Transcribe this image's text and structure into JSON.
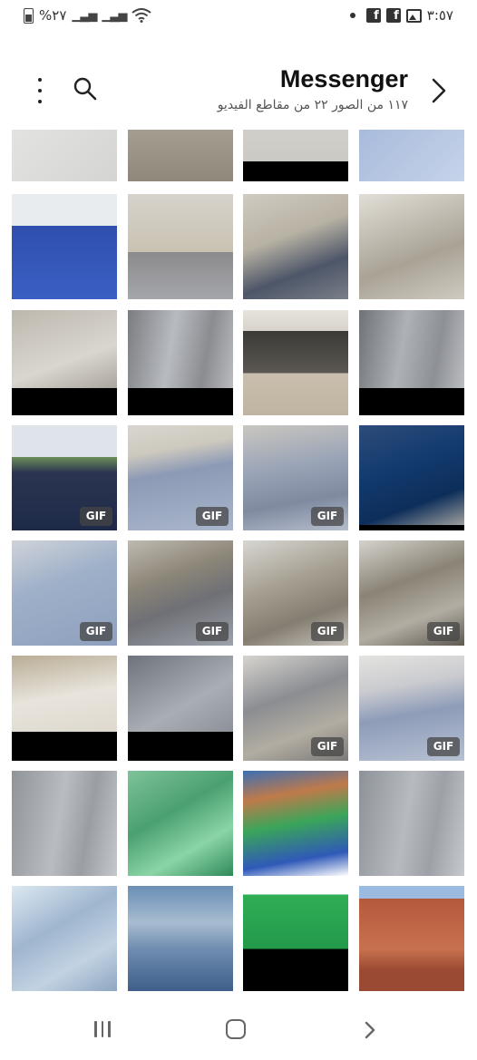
{
  "status_bar": {
    "battery_text": "%٢٧",
    "time": "٣:٥٧"
  },
  "header": {
    "title": "Messenger",
    "subtitle": "١١٧ من الصور ٢٢ من مقاطع الفيديو"
  },
  "gif_label": "GIF",
  "thumbnails": [
    {
      "row": 0,
      "col": 0,
      "bg": "linear-gradient(135deg,#e8e8e6,#d4d4d2)",
      "gif": false,
      "letterbox": 0
    },
    {
      "row": 0,
      "col": 1,
      "bg": "linear-gradient(180deg,#b9b4a8,#8f887a)",
      "gif": false,
      "letterbox": 0
    },
    {
      "row": 0,
      "col": 2,
      "bg": "linear-gradient(180deg,#d9d8d4,#c8c6c0)",
      "gif": false,
      "letterbox": 22
    },
    {
      "row": 0,
      "col": 3,
      "bg": "linear-gradient(135deg,#9eb3d6,#c6d3ea)",
      "gif": false,
      "letterbox": 0
    },
    {
      "row": 1,
      "col": 0,
      "bg": "linear-gradient(180deg,#e9ecef 0%,#e9ecef 30%,#2f4fae 30%,#3a5fc4 100%)",
      "gif": false,
      "letterbox": 0
    },
    {
      "row": 1,
      "col": 1,
      "bg": "linear-gradient(180deg,#d6d3cc 0%,#c9c2b2 55%,#8b8b8d 55%,#a5a6aa 100%)",
      "gif": false,
      "letterbox": 0
    },
    {
      "row": 1,
      "col": 2,
      "bg": "linear-gradient(160deg,#cfcbc1 0%,#b8b2a4 40%,#4d5668 70%,#7a7f88 100%)",
      "gif": false,
      "letterbox": 0
    },
    {
      "row": 1,
      "col": 3,
      "bg": "linear-gradient(160deg,#e1ded6,#a9a396 60%,#cfcac0)",
      "gif": false,
      "letterbox": 0
    },
    {
      "row": 2,
      "col": 0,
      "bg": "linear-gradient(160deg,#bdb8ae,#d9d6cf 50%,#8e887d)",
      "gif": false,
      "letterbox": 30
    },
    {
      "row": 2,
      "col": 1,
      "bg": "linear-gradient(100deg,#7a7c80,#b8bbc0 40%,#8a8c90 70%,#c0c2c6)",
      "gif": false,
      "letterbox": 30
    },
    {
      "row": 2,
      "col": 2,
      "bg": "linear-gradient(180deg,#e7e4dd 0%,#d7d3ca 20%,#3c3a36 20%,#5b5853 60%,#c9bfae 60%,#bfb4a1 100%)",
      "gif": false,
      "letterbox": 0
    },
    {
      "row": 2,
      "col": 3,
      "bg": "linear-gradient(100deg,#6f7276,#aeb1b6 40%,#8d9095 70%,#c2c4c8)",
      "gif": false,
      "letterbox": 30
    },
    {
      "row": 3,
      "col": 0,
      "bg": "linear-gradient(180deg,#dfe4ea 0%,#dfe4ea 30%,#6d8f58 30%,#2b3550 45%,#1d2a48 100%)",
      "gif": true,
      "letterbox": 0
    },
    {
      "row": 3,
      "col": 1,
      "bg": "linear-gradient(170deg,#d8d6cf 0%,#cdc9bf 25%,#8c9ab5 45%,#a9b6cc 100%)",
      "gif": true,
      "letterbox": 0
    },
    {
      "row": 3,
      "col": 2,
      "bg": "linear-gradient(170deg,#c9c6bf 0%,#9aa4b7 40%,#7f8aa0 70%,#b5bdcc 100%)",
      "gif": true,
      "letterbox": 0
    },
    {
      "row": 3,
      "col": 3,
      "bg": "linear-gradient(160deg,#2d4c7a 0%,#123a6e 40%,#0d2e5a 70%,#b5b0a6 100%)",
      "gif": false,
      "letterbox": 6
    },
    {
      "row": 4,
      "col": 0,
      "bg": "linear-gradient(160deg,#cfd3d9,#9fb0c9 40%,#8ea0bd 100%)",
      "gif": true,
      "letterbox": 0
    },
    {
      "row": 4,
      "col": 1,
      "bg": "linear-gradient(160deg,#bfbab0,#8c8678 35%,#6f7076 60%,#9ea2ab)",
      "gif": true,
      "letterbox": 0
    },
    {
      "row": 4,
      "col": 2,
      "bg": "linear-gradient(160deg,#d7d6d2,#a6a092 40%,#847d71 70%,#c7c3bb)",
      "gif": true,
      "letterbox": 0
    },
    {
      "row": 4,
      "col": 3,
      "bg": "linear-gradient(160deg,#d4d2cc,#8a8476 40%,#b2ada2 70%,#5e5a52)",
      "gif": true,
      "letterbox": 0
    },
    {
      "row": 5,
      "col": 0,
      "bg": "linear-gradient(170deg,#b9ad95,#e8e4dc 40%,#d8d2c6)",
      "gif": false,
      "letterbox": 32
    },
    {
      "row": 5,
      "col": 1,
      "bg": "linear-gradient(150deg,#6f747c,#a9adb4 50%,#7d8189)",
      "gif": false,
      "letterbox": 32
    },
    {
      "row": 5,
      "col": 2,
      "bg": "linear-gradient(160deg,#d6d4cf,#8b8d92 40%,#b2ada2 70%,#7b7a78)",
      "gif": true,
      "letterbox": 0
    },
    {
      "row": 5,
      "col": 3,
      "bg": "linear-gradient(170deg,#e4e3e0 0%,#cacbcf 30%,#8e9cb8 55%,#b7c1d3 100%)",
      "gif": true,
      "letterbox": 0
    },
    {
      "row": 6,
      "col": 0,
      "bg": "linear-gradient(100deg,#8f9499,#b9bcc1 45%,#9a9ea3 70%,#c4c7cb)",
      "gif": false,
      "letterbox": 0
    },
    {
      "row": 6,
      "col": 1,
      "bg": "linear-gradient(150deg,#7fc29a,#4aa070 40%,#8bd4a8 70%,#2e8a58)",
      "gif": false,
      "letterbox": 0
    },
    {
      "row": 6,
      "col": 2,
      "bg": "linear-gradient(170deg,#3b6fb5 0%,#c07a4a 25%,#3aa55a 50%,#2f59b8 80%,#ffffff 100%)",
      "gif": false,
      "letterbox": 0
    },
    {
      "row": 6,
      "col": 3,
      "bg": "linear-gradient(100deg,#8d9298,#b7bbc0 45%,#9da1a7 70%,#c6c9cd)",
      "gif": false,
      "letterbox": 0
    },
    {
      "row": 7,
      "col": 0,
      "bg": "linear-gradient(150deg,#dce8f2,#9fb6cf 40%,#c2d2e2 70%,#8ea6c2)",
      "gif": false,
      "letterbox": 0
    },
    {
      "row": 7,
      "col": 1,
      "bg": "linear-gradient(180deg,#6a8fb5 0%,#a7bcd0 35%,#6f8db0 60%,#3f5f8a 100%)",
      "gif": false,
      "letterbox": 0
    },
    {
      "row": 7,
      "col": 2,
      "bg": "linear-gradient(180deg,#ffffff 0%,#ffffff 8%,#2fae55 8%,#23994a 60%,#000000 60%)",
      "gif": false,
      "letterbox": 0
    },
    {
      "row": 7,
      "col": 3,
      "bg": "linear-gradient(180deg,#9bbbe0 0%,#9bbbe0 12%,#b5593c 12%,#c8714f 60%,#9a4a33 80%)",
      "gif": false,
      "letterbox": 0
    }
  ]
}
